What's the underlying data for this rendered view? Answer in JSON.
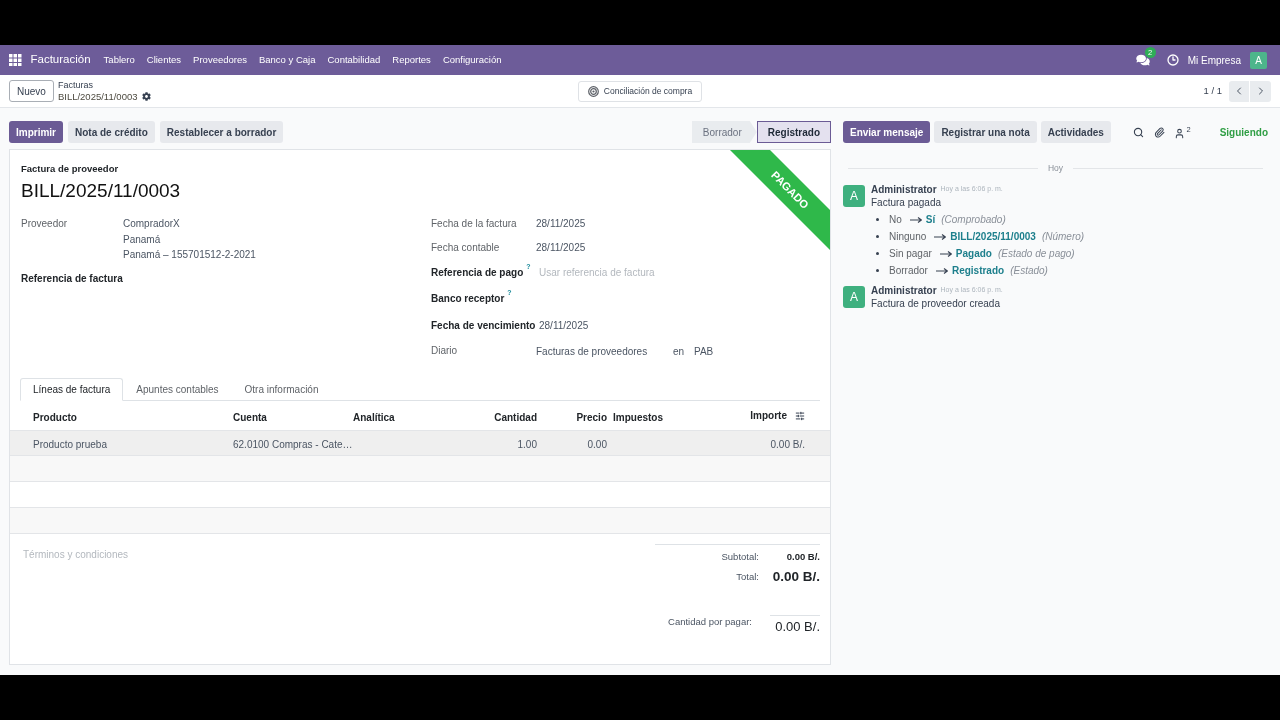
{
  "navbar": {
    "app_name": "Facturación",
    "menu": [
      "Tablero",
      "Clientes",
      "Proveedores",
      "Banco y Caja",
      "Contabilidad",
      "Reportes",
      "Configuración"
    ],
    "messages_badge": "2",
    "company": "Mi Empresa",
    "avatar": "A"
  },
  "control_panel": {
    "new_button": "Nuevo",
    "breadcrumb": {
      "parent": "Facturas",
      "current": "BILL/2025/11/0003"
    },
    "center_button": "Conciliación de compra",
    "pager": "1 / 1"
  },
  "action_buttons": [
    {
      "label": "Imprimir",
      "primary": true
    },
    {
      "label": "Nota de crédito",
      "primary": false
    },
    {
      "label": "Restablecer a borrador",
      "primary": false
    }
  ],
  "status_steps": [
    {
      "label": "Borrador",
      "selected": false
    },
    {
      "label": "Registrado",
      "selected": true
    }
  ],
  "form": {
    "type_label": "Factura de proveedor",
    "title": "BILL/2025/11/0003",
    "ribbon": "PAGADO",
    "left_fields": [
      {
        "label": "Proveedor",
        "bold": false,
        "lines": [
          "CompradorX",
          "Panamá",
          "Panamá – 155701512-2-2021"
        ]
      },
      {
        "label": "Referencia de factura",
        "bold": true
      }
    ],
    "right_fields": [
      {
        "label": "Fecha de la factura",
        "bold": false,
        "value": "28/11/2025"
      },
      {
        "label": "Fecha contable",
        "bold": false,
        "value": "28/11/2025"
      },
      {
        "label": "Referencia de pago",
        "bold": true,
        "help": "?",
        "placeholder": "Usar referencia de factura"
      },
      {
        "label": "Banco receptor",
        "bold": true,
        "help": "?"
      },
      {
        "label": "Fecha de vencimiento",
        "bold": true,
        "value": "28/11/2025"
      },
      {
        "label": "Diario",
        "bold": false,
        "values": [
          "Facturas de proveedores",
          "en",
          "PAB"
        ]
      }
    ]
  },
  "notebook": {
    "tabs": [
      {
        "label": "Líneas de factura",
        "selected": true
      },
      {
        "label": "Apuntes contables",
        "selected": false
      },
      {
        "label": "Otra información",
        "selected": false
      }
    ],
    "table": {
      "columns": [
        "Producto",
        "Cuenta",
        "Analítica",
        "Cantidad",
        "Precio",
        "Impuestos",
        "Importe"
      ],
      "rows": [
        {
          "product": "Producto prueba",
          "account": "62.0100 Compras - Cate…",
          "quantity": "1.00",
          "price": "0.00",
          "amount": "0.00 B/."
        }
      ]
    },
    "terms": {
      "placeholder": "Términos y condiciones"
    },
    "totals": [
      {
        "kind": "subtotal",
        "label": "Subtotal:",
        "value": "0.00 B/."
      },
      {
        "kind": "total",
        "label": "Total:",
        "value": "0.00 B/."
      }
    ],
    "amount_due": {
      "label": "Cantidad por pagar:",
      "value": "0.00 B/."
    }
  },
  "chatter": {
    "buttons": [
      {
        "label": "Enviar mensaje",
        "primary": true
      },
      {
        "label": "Registrar una nota",
        "primary": false
      },
      {
        "label": "Actividades",
        "primary": false
      }
    ],
    "followers_count": "2",
    "follow_status": "Siguiendo",
    "date_divider": "Hoy",
    "messages": [
      {
        "avatar": "A",
        "author": "Administrator",
        "time": "Hoy a las 6:06 p. m.",
        "body": "Factura pagada",
        "changes": [
          {
            "old": "No",
            "new": "Sí",
            "field": "(Comprobado)"
          },
          {
            "old": "Ninguno",
            "new": "BILL/2025/11/0003",
            "field": "(Número)"
          },
          {
            "old": "Sin pagar",
            "new": "Pagado",
            "field": "(Estado de pago)"
          },
          {
            "old": "Borrador",
            "new": "Registrado",
            "field": "(Estado)"
          }
        ]
      },
      {
        "avatar": "A",
        "author": "Administrator",
        "time": "Hoy a las 6:06 p. m.",
        "body": "Factura de proveedor creada"
      }
    ]
  }
}
